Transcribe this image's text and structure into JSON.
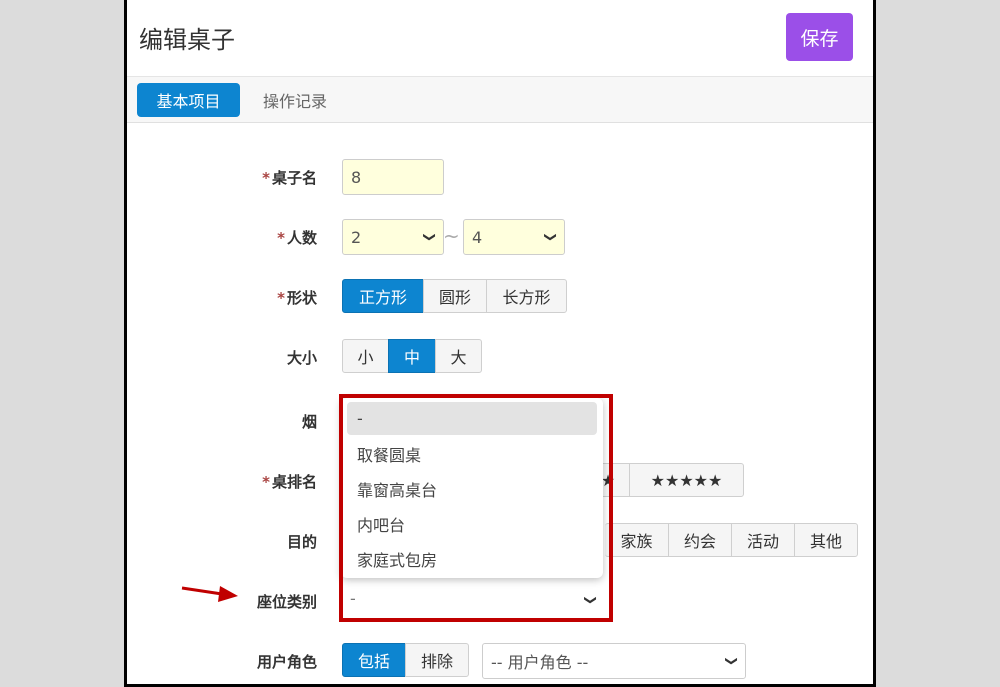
{
  "header": {
    "title": "编辑桌子",
    "save_label": "保存"
  },
  "tabs": [
    {
      "label": "基本项目",
      "active": true
    },
    {
      "label": "操作记录",
      "active": false
    }
  ],
  "form": {
    "required_mark": "*",
    "table_name": {
      "label": "桌子名",
      "value": "8"
    },
    "people": {
      "label": "人数",
      "min": "2",
      "sep": "~",
      "max": "4"
    },
    "shape": {
      "label": "形状",
      "options": [
        "正方形",
        "圆形",
        "长方形"
      ],
      "selected": "正方形"
    },
    "size": {
      "label": "大小",
      "options": [
        "小",
        "中",
        "大"
      ],
      "selected": "中"
    },
    "smoke": {
      "label": "烟"
    },
    "rank": {
      "label": "桌排名",
      "partial_star": "★",
      "stars5": "★★★★★"
    },
    "purpose": {
      "label": "目的",
      "options": [
        "家族",
        "约会",
        "活动",
        "其他"
      ]
    },
    "seat_type": {
      "label": "座位类别",
      "value": "-"
    },
    "user_role": {
      "label": "用户角色",
      "options": [
        "包括",
        "排除"
      ],
      "selected": "包括",
      "select_value": "-- 用户角色 --"
    }
  },
  "seat_dropdown": {
    "options": [
      "-",
      "取餐圆桌",
      "靠窗高桌台",
      "内吧台",
      "家庭式包房"
    ],
    "highlighted": "-"
  },
  "colors": {
    "accent": "#0d85d0",
    "save": "#9b4fe8",
    "highlight_box": "#c00000",
    "input_bg": "#ffffdd"
  },
  "icons": {
    "dropdown_caret": "chevron-down-icon",
    "pointer": "red-arrow-icon"
  }
}
